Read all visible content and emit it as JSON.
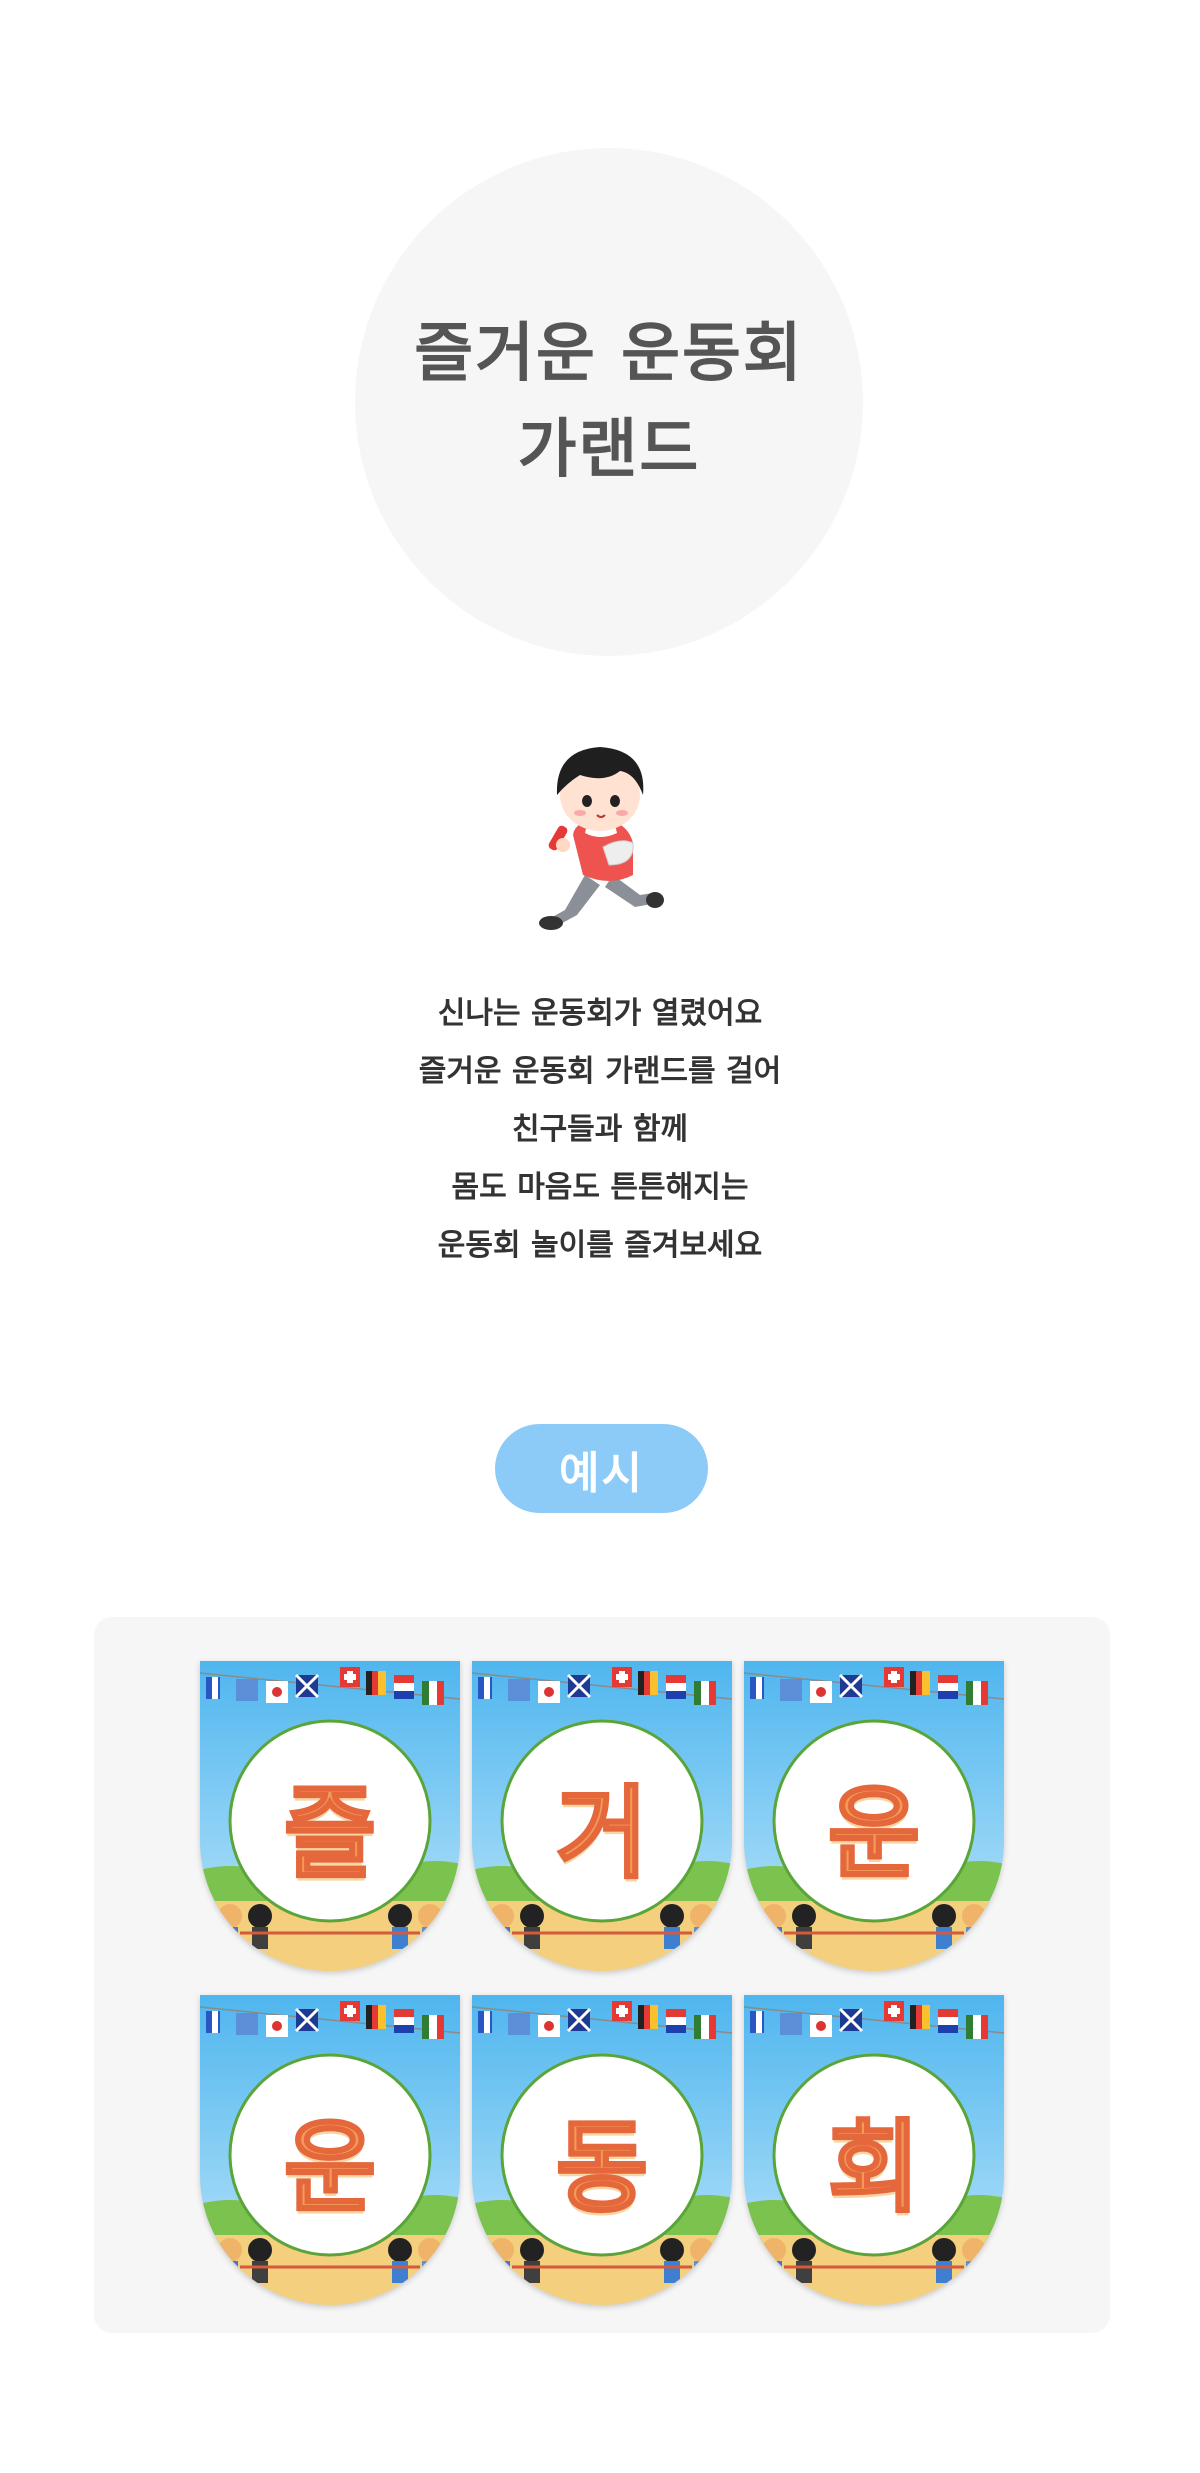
{
  "hero": {
    "title_line1": "즐거운 운동회",
    "title_line2": "가랜드"
  },
  "mascot": {
    "icon": "running-boy-icon"
  },
  "intro": {
    "lines": [
      "신나는 운동회가 열렸어요",
      "즐거운 운동회 가랜드를 걸어",
      "친구들과 함께",
      "몸도 마음도 튼튼해지는",
      "운동회 놀이를 즐겨보세요"
    ]
  },
  "example_label": "예시",
  "pennants": [
    {
      "letter": "즐"
    },
    {
      "letter": "거"
    },
    {
      "letter": "운"
    },
    {
      "letter": "운"
    },
    {
      "letter": "동"
    },
    {
      "letter": "회"
    }
  ],
  "colors": {
    "pill": "#8ccbf7",
    "panel": "#f6f6f6",
    "hero_circle": "#f6f6f6",
    "letter_fill": "#f39a55",
    "letter_stroke": "#e5673c",
    "circle_border": "#5aa53a"
  }
}
